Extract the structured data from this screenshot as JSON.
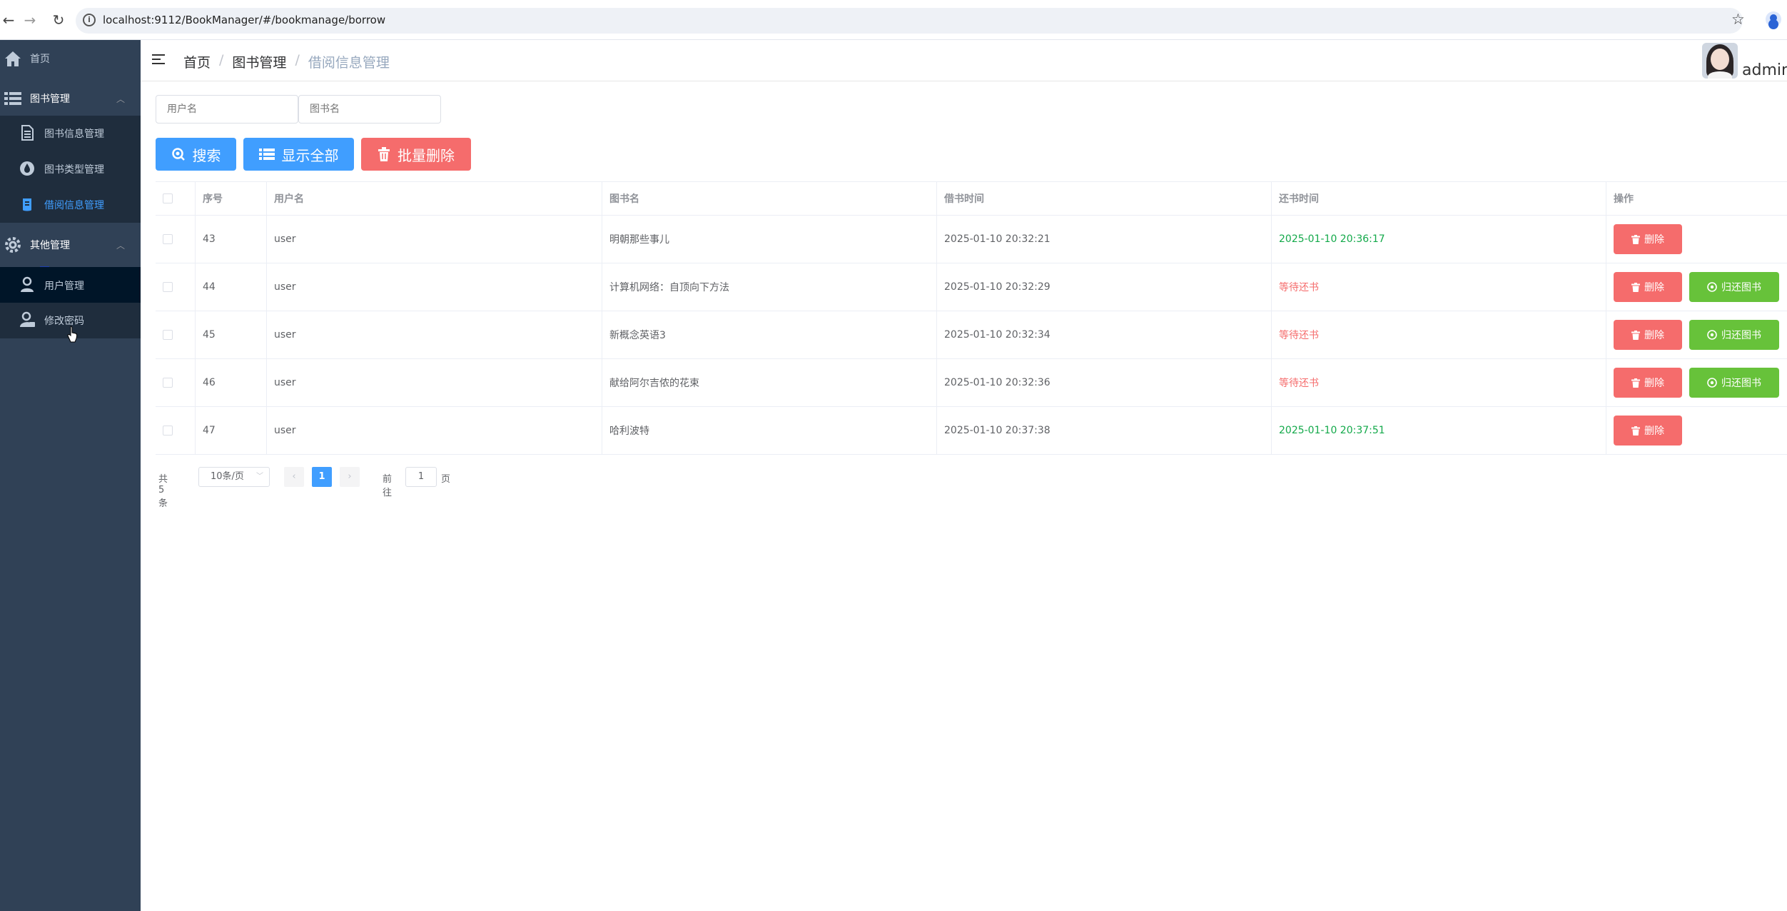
{
  "browser": {
    "url": "localhost:9112/BookManager/#/bookmanage/borrow"
  },
  "sidebar": {
    "items": [
      {
        "label": "首页",
        "icon": "home-icon"
      },
      {
        "label": "图书管理",
        "icon": "list-icon",
        "expanded": true,
        "children": [
          {
            "label": "图书信息管理",
            "icon": "document-icon"
          },
          {
            "label": "图书类型管理",
            "icon": "drop-icon"
          },
          {
            "label": "借阅信息管理",
            "icon": "borrow-icon",
            "active": true
          }
        ]
      },
      {
        "label": "其他管理",
        "icon": "gear-icon",
        "expanded": true,
        "children": [
          {
            "label": "用户管理",
            "icon": "user-icon",
            "hovered": true
          },
          {
            "label": "修改密码",
            "icon": "lock-user-icon"
          }
        ]
      }
    ]
  },
  "header": {
    "breadcrumb": [
      "首页",
      "图书管理",
      "借阅信息管理"
    ],
    "username": "admin"
  },
  "search": {
    "username_placeholder": "用户名",
    "bookname_placeholder": "图书名",
    "search_label": "搜索",
    "show_all_label": "显示全部",
    "batch_delete_label": "批量删除"
  },
  "table": {
    "columns": [
      "序号",
      "用户名",
      "图书名",
      "借书时间",
      "还书时间",
      "操作"
    ],
    "rows": [
      {
        "id": "43",
        "user": "user",
        "book": "明朝那些事儿",
        "borrow_time": "2025-01-10 20:32:21",
        "return_time": "2025-01-10 20:36:17",
        "returned": true
      },
      {
        "id": "44",
        "user": "user",
        "book": "计算机网络：自顶向下方法",
        "borrow_time": "2025-01-10 20:32:29",
        "return_time": "等待还书",
        "returned": false
      },
      {
        "id": "45",
        "user": "user",
        "book": "新概念英语3",
        "borrow_time": "2025-01-10 20:32:34",
        "return_time": "等待还书",
        "returned": false
      },
      {
        "id": "46",
        "user": "user",
        "book": "献给阿尔吉侬的花束",
        "borrow_time": "2025-01-10 20:32:36",
        "return_time": "等待还书",
        "returned": false
      },
      {
        "id": "47",
        "user": "user",
        "book": "哈利波特",
        "borrow_time": "2025-01-10 20:37:38",
        "return_time": "2025-01-10 20:37:51",
        "returned": true
      }
    ],
    "delete_label": "删除",
    "return_label": "归还图书"
  },
  "pagination": {
    "total": "共 5 条",
    "page_size": "10条/页",
    "current_page": "1",
    "goto_prefix": "前往",
    "goto_value": "1",
    "goto_suffix": "页"
  },
  "colors": {
    "sidebar_bg": "#304156",
    "primary": "#409eff",
    "danger": "#f56c6c",
    "success": "#67c23a"
  }
}
